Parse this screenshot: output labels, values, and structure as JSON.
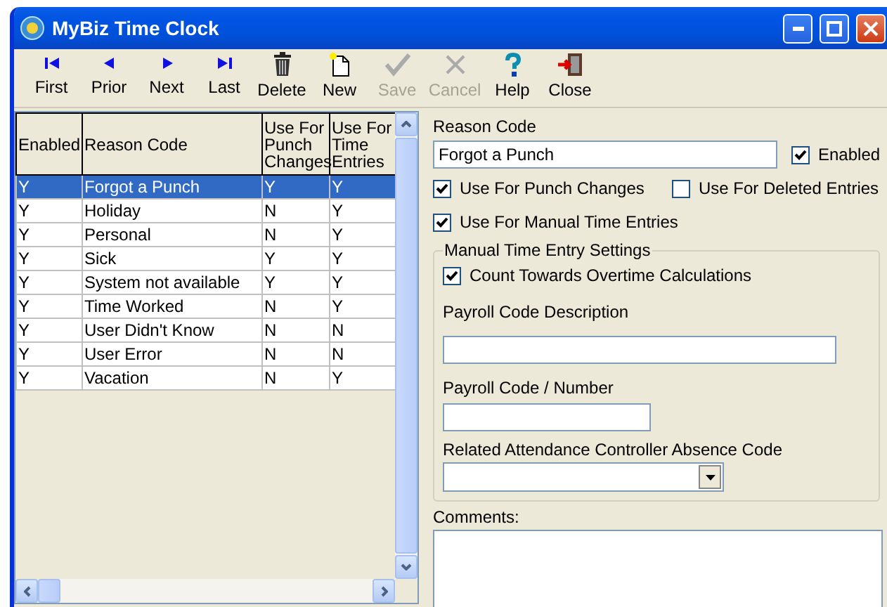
{
  "window": {
    "title": "MyBiz Time Clock"
  },
  "toolbar": [
    {
      "kind": "first",
      "label": "First",
      "disabled": false
    },
    {
      "kind": "prior",
      "label": "Prior",
      "disabled": false
    },
    {
      "kind": "next",
      "label": "Next",
      "disabled": false
    },
    {
      "kind": "last",
      "label": "Last",
      "disabled": false
    },
    {
      "kind": "delete",
      "label": "Delete",
      "disabled": false
    },
    {
      "kind": "new",
      "label": "New",
      "disabled": false
    },
    {
      "kind": "save",
      "label": "Save",
      "disabled": true
    },
    {
      "kind": "cancel",
      "label": "Cancel",
      "disabled": true
    },
    {
      "kind": "help",
      "label": "Help",
      "disabled": false
    },
    {
      "kind": "close",
      "label": "Close",
      "disabled": false
    }
  ],
  "table": {
    "columns": [
      "Enabled",
      "Reason Code",
      "Use For Punch Changes",
      "Use For Time Entries"
    ],
    "rows": [
      {
        "cells": [
          "Y",
          "Forgot a Punch",
          "Y",
          "Y"
        ],
        "selected": true
      },
      {
        "cells": [
          "Y",
          "Holiday",
          "N",
          "Y"
        ],
        "selected": false
      },
      {
        "cells": [
          "Y",
          "Personal",
          "N",
          "Y"
        ],
        "selected": false
      },
      {
        "cells": [
          "Y",
          "Sick",
          "Y",
          "Y"
        ],
        "selected": false
      },
      {
        "cells": [
          "Y",
          "System not available",
          "Y",
          "Y"
        ],
        "selected": false
      },
      {
        "cells": [
          "Y",
          "Time Worked",
          "N",
          "Y"
        ],
        "selected": false
      },
      {
        "cells": [
          "Y",
          "User Didn't Know",
          "N",
          "N"
        ],
        "selected": false
      },
      {
        "cells": [
          "Y",
          "User Error",
          "N",
          "N"
        ],
        "selected": false
      },
      {
        "cells": [
          "Y",
          "Vacation",
          "N",
          "Y"
        ],
        "selected": false
      }
    ]
  },
  "form": {
    "reason_code": {
      "label": "Reason Code",
      "value": "Forgot a Punch"
    },
    "enabled": {
      "label": "Enabled",
      "checked": true
    },
    "options": [
      {
        "label": "Use For Punch Changes",
        "checked": true
      },
      {
        "label": "Use For Deleted Entries",
        "checked": false
      },
      {
        "label": "Use For Manual Time Entries",
        "checked": true
      }
    ],
    "group": {
      "title": "Manual Time Entry Settings",
      "overtime": {
        "label": "Count Towards Overtime Calculations",
        "checked": true
      },
      "payroll_description": {
        "label": "Payroll Code Description"
      },
      "payroll_number": {
        "label": "Payroll Code / Number"
      },
      "absence_code": {
        "label": "Related Attendance Controller Absence Code"
      }
    },
    "comments": {
      "label": "Comments:"
    }
  }
}
